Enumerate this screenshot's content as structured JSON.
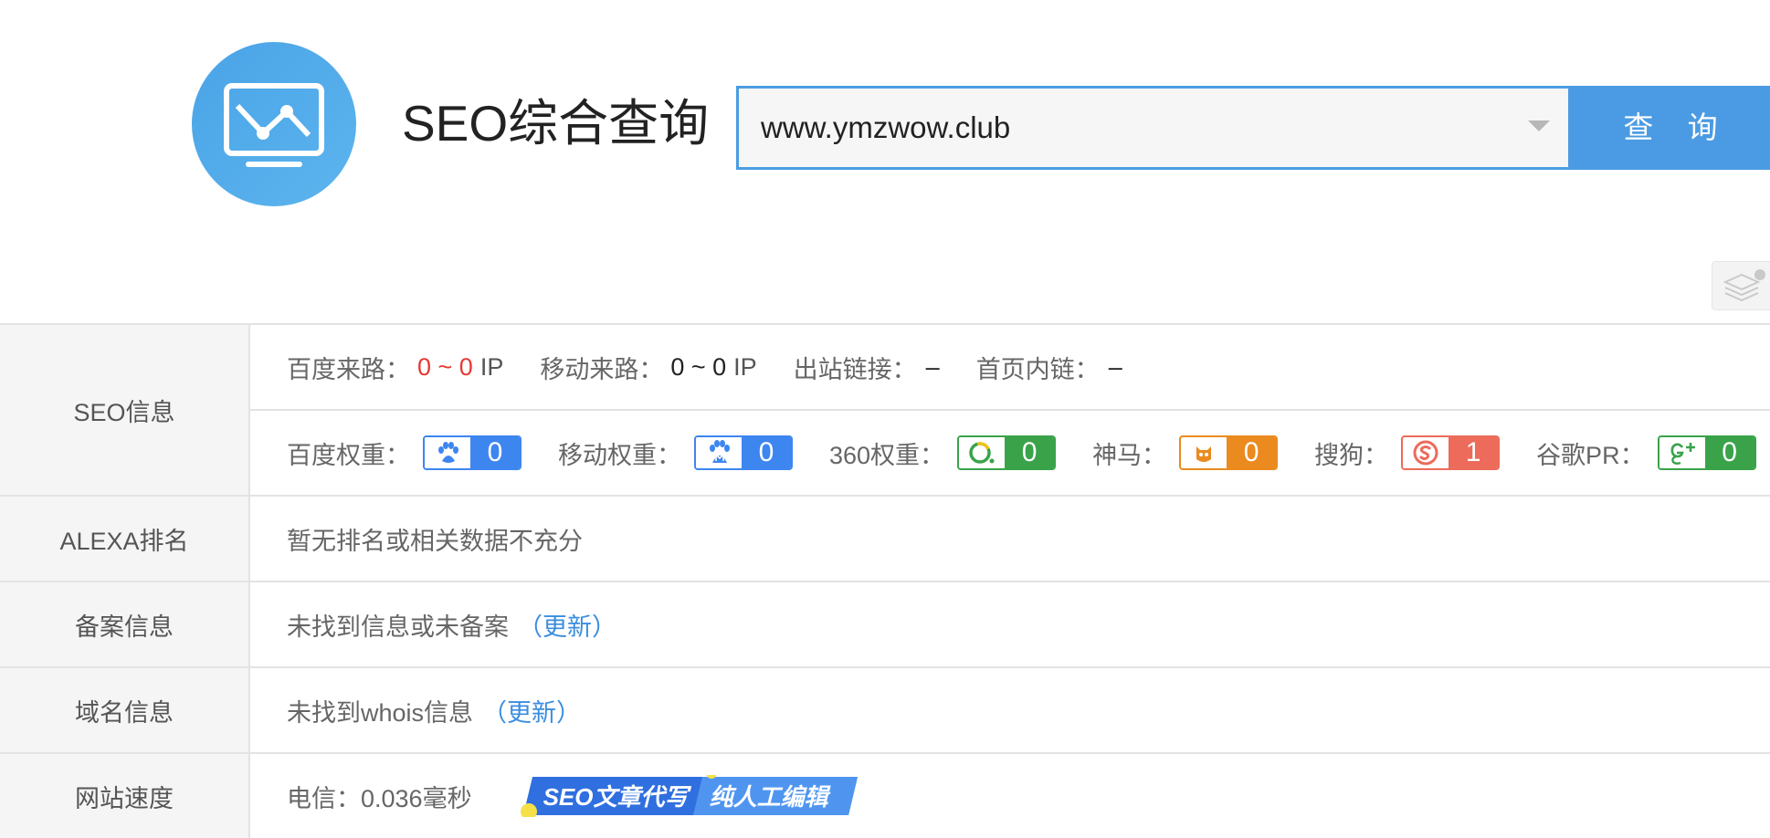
{
  "header": {
    "title": "SEO综合查询",
    "search_value": "www.ymzwow.club",
    "query_button": "查 询"
  },
  "colors": {
    "accent": "#4a9be3",
    "red_value": "#e53935",
    "link": "#3a8ddf"
  },
  "seo_info": {
    "label": "SEO信息",
    "baidu_traffic_label": "百度来路：",
    "baidu_traffic_value": "0 ~ 0",
    "baidu_traffic_unit": "IP",
    "mobile_traffic_label": "移动来路：",
    "mobile_traffic_value": "0 ~ 0",
    "mobile_traffic_unit": "IP",
    "outbound_links_label": "出站链接：",
    "outbound_links_value": "–",
    "homepage_links_label": "首页内链：",
    "homepage_links_value": "–",
    "weights": [
      {
        "label": "百度权重：",
        "value": "0",
        "icon": "baidu-paw-icon",
        "color": "#3d86f0"
      },
      {
        "label": "移动权重：",
        "value": "0",
        "icon": "baidu-mobile-paw-icon",
        "color": "#3d86f0"
      },
      {
        "label": "360权重：",
        "value": "0",
        "icon": "so360-icon",
        "color": "#3aa34a"
      },
      {
        "label": "神马：",
        "value": "0",
        "icon": "shenma-icon",
        "color": "#ea8a1f"
      },
      {
        "label": "搜狗：",
        "value": "1",
        "icon": "sogou-icon",
        "color": "#ec6b5a"
      },
      {
        "label": "谷歌PR：",
        "value": "0",
        "icon": "google-plus-icon",
        "color": "#3aa34a"
      }
    ]
  },
  "alexa": {
    "label": "ALEXA排名",
    "value": "暂无排名或相关数据不充分"
  },
  "icp": {
    "label": "备案信息",
    "value": "未找到信息或未备案",
    "update_link": "（更新）"
  },
  "domain": {
    "label": "域名信息",
    "value": "未找到whois信息",
    "update_link": "（更新）"
  },
  "speed": {
    "label": "网站速度",
    "value": "电信：0.036毫秒",
    "promo_left": "SEO文章代写",
    "promo_right": "纯人工编辑"
  }
}
